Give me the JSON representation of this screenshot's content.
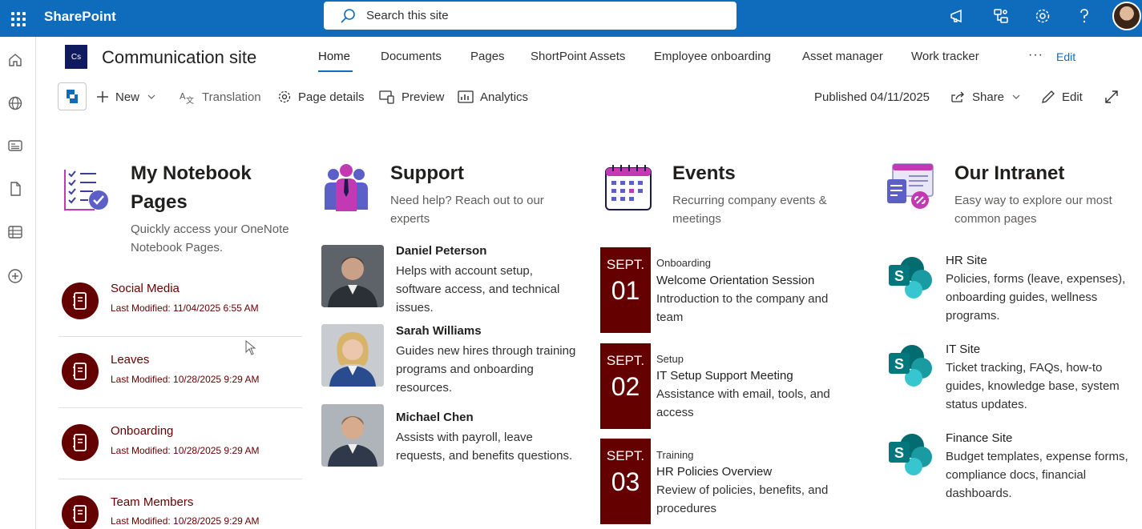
{
  "suite": {
    "brand": "SharePoint",
    "search_placeholder": "Search this site"
  },
  "site": {
    "logo_text": "Cs",
    "title": "Communication site",
    "nav": [
      "Home",
      "Documents",
      "Pages",
      "ShortPoint Assets",
      "Employee onboarding",
      "Asset manager",
      "Work tracker"
    ],
    "nav_more": "···",
    "nav_edit": "Edit"
  },
  "commands": {
    "new": "New",
    "translation": "Translation",
    "page_details": "Page details",
    "preview": "Preview",
    "analytics": "Analytics",
    "published": "Published 04/11/2025",
    "share": "Share",
    "edit": "Edit"
  },
  "notebook": {
    "title_line1": "My Notebook",
    "title_line2": "Pages",
    "subtitle_line1": "Quickly access your OneNote",
    "subtitle_line2": "Notebook Pages.",
    "items": [
      {
        "name": "Social Media",
        "modified": "Last Modified: 11/04/2025 6:55 AM"
      },
      {
        "name": "Leaves",
        "modified": "Last Modified: 10/28/2025 9:29 AM"
      },
      {
        "name": "Onboarding",
        "modified": "Last Modified: 10/28/2025 9:29 AM"
      },
      {
        "name": "Team Members",
        "modified": "Last Modified: 10/28/2025 9:29 AM"
      }
    ]
  },
  "support": {
    "title": "Support",
    "subtitle_line1": "Need help? Reach out to our",
    "subtitle_line2": "experts",
    "people": [
      {
        "name": "Daniel Peterson",
        "desc": [
          "Helps with account setup,",
          "software access, and technical",
          "issues."
        ]
      },
      {
        "name": "Sarah Williams",
        "desc": [
          "Guides new hires through training",
          "programs and onboarding",
          "resources."
        ]
      },
      {
        "name": "Michael Chen",
        "desc": [
          "Assists with payroll, leave",
          "requests, and benefits questions."
        ]
      }
    ]
  },
  "events": {
    "title": "Events",
    "subtitle_line1": "Recurring company events &",
    "subtitle_line2": "meetings",
    "items": [
      {
        "month": "SEPT.",
        "day": "01",
        "category": "Onboarding",
        "title": "Welcome Orientation Session",
        "desc": [
          "Introduction to the company and",
          "team"
        ]
      },
      {
        "month": "SEPT.",
        "day": "02",
        "category": "Setup",
        "title": "IT Setup Support Meeting",
        "desc": [
          "Assistance with email, tools, and",
          "access"
        ]
      },
      {
        "month": "SEPT.",
        "day": "03",
        "category": "Training",
        "title": "HR Policies Overview",
        "desc": [
          "Review of policies, benefits, and",
          "procedures"
        ]
      }
    ]
  },
  "intranet": {
    "title": "Our Intranet",
    "subtitle_line1": "Easy way to explore our most",
    "subtitle_line2": "common pages",
    "links": [
      {
        "name": "HR Site",
        "desc": [
          "Policies, forms (leave, expenses),",
          "onboarding guides, wellness",
          "programs."
        ]
      },
      {
        "name": "IT Site",
        "desc": [
          "Ticket tracking, FAQs, how-to",
          "guides, knowledge base, system",
          "status updates."
        ]
      },
      {
        "name": "Finance Site",
        "desc": [
          "Budget templates, expense forms,",
          "compliance docs, financial",
          "dashboards."
        ]
      }
    ]
  },
  "colors": {
    "suite_blue": "#0f6cbd",
    "maroon": "#650000",
    "sharepoint_teal": "#036c70"
  }
}
